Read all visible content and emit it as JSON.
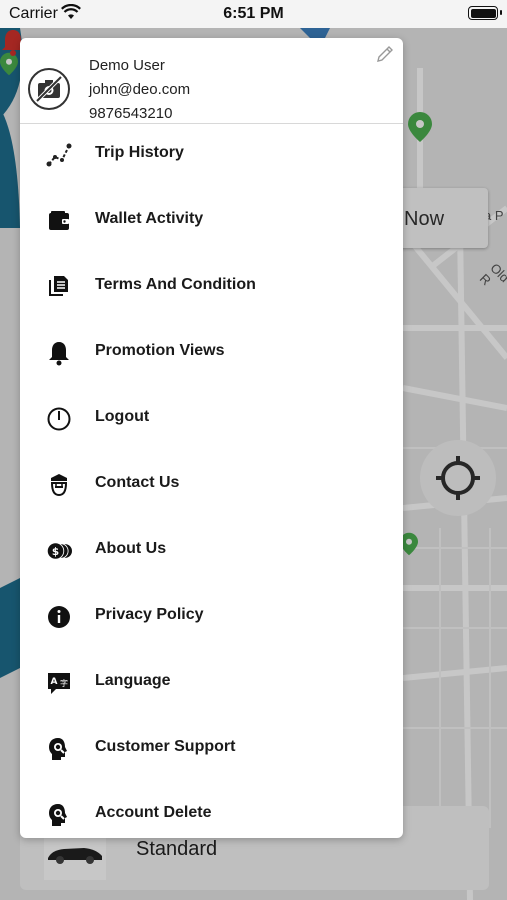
{
  "status_bar": {
    "carrier": "Carrier",
    "time": "6:51 PM"
  },
  "map": {
    "now_button_label": "Now",
    "vehicle_label": "Standard",
    "street_labels": [
      "a P",
      "Old R"
    ]
  },
  "profile": {
    "name": "Demo User",
    "email": "john@deo.com",
    "phone": "9876543210"
  },
  "menu": [
    {
      "label": "Trip History",
      "icon": "route-icon"
    },
    {
      "label": "Wallet Activity",
      "icon": "wallet-icon"
    },
    {
      "label": "Terms And Condition",
      "icon": "documents-icon"
    },
    {
      "label": "Promotion Views",
      "icon": "bell-icon"
    },
    {
      "label": "Logout",
      "icon": "power-icon"
    },
    {
      "label": "Contact Us",
      "icon": "agent-icon"
    },
    {
      "label": "About Us",
      "icon": "coins-icon"
    },
    {
      "label": "Privacy Policy",
      "icon": "info-icon"
    },
    {
      "label": "Language",
      "icon": "translate-icon"
    },
    {
      "label": "Customer Support",
      "icon": "support-icon"
    },
    {
      "label": "Account Delete",
      "icon": "account-delete-icon"
    }
  ],
  "colors": {
    "accent_blue": "#1e6e8e",
    "alert_red": "#d3322c",
    "map_green": "#4caf50"
  }
}
